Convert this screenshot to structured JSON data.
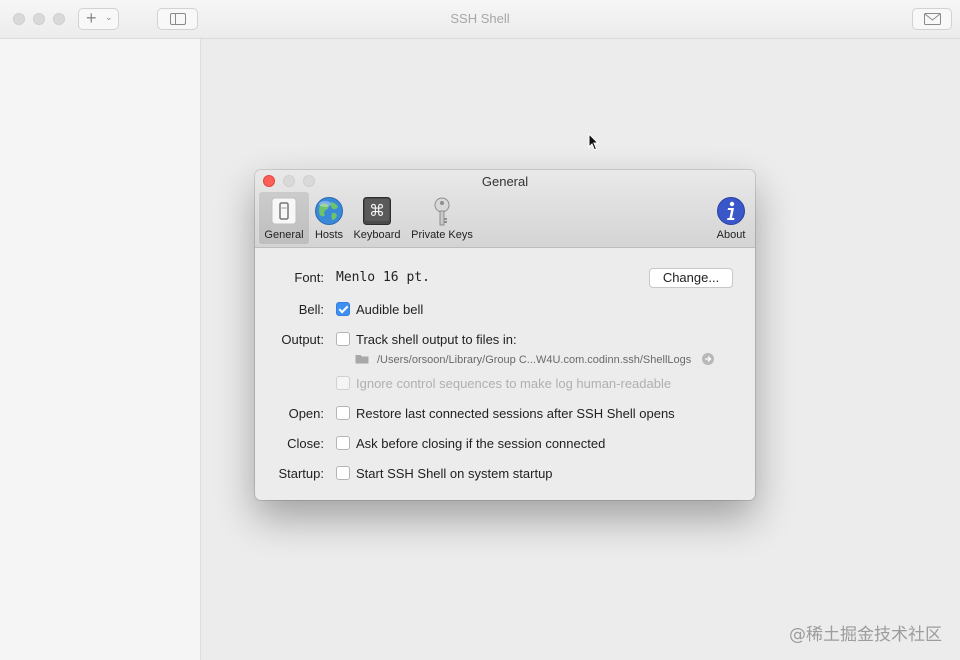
{
  "window": {
    "title": "SSH Shell",
    "add_button_label": "+"
  },
  "prefs": {
    "title": "General",
    "tabs": [
      {
        "label": "General",
        "icon": "switch-icon",
        "selected": true
      },
      {
        "label": "Hosts",
        "icon": "globe-icon"
      },
      {
        "label": "Keyboard",
        "icon": "command-key-icon"
      },
      {
        "label": "Private Keys",
        "icon": "key-icon"
      }
    ],
    "about_label": "About",
    "font": {
      "label": "Font:",
      "value": "Menlo 16 pt.",
      "change_label": "Change..."
    },
    "bell": {
      "label": "Bell:",
      "option": "Audible bell",
      "checked": true
    },
    "output": {
      "label": "Output:",
      "option": "Track shell output to files in:",
      "checked": false,
      "path": "/Users/orsoon/Library/Group C...W4U.com.codinn.ssh/ShellLogs",
      "ignore_option": "Ignore control sequences to make log human-readable"
    },
    "open": {
      "label": "Open:",
      "option": "Restore last connected sessions after SSH Shell opens",
      "checked": false
    },
    "close": {
      "label": "Close:",
      "option": "Ask before closing if the session connected",
      "checked": false
    },
    "startup": {
      "label": "Startup:",
      "option": "Start SSH Shell on system startup",
      "checked": false
    }
  },
  "watermark": "@稀土掘金技术社区",
  "colors": {
    "accent": "#3d8ff2",
    "close": "#fc5f57"
  }
}
